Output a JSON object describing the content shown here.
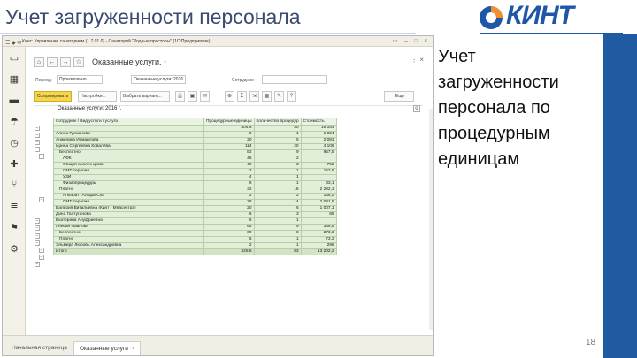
{
  "slide": {
    "title": "Учет загруженности персонала",
    "logo_text": "КИНТ",
    "caption": "Учет загруженности персонала по процедурным единицам",
    "page_number": "18"
  },
  "app": {
    "window_title": "Кинт: Управление санаторием (1.7.01.0) - Санаторий \"Родные просторы\" (1С:Предприятие)",
    "doc_title": "Оказанные услуги.",
    "doc_modified_mark": "*",
    "filters": {
      "period_label": "Период:",
      "period_value": "Произвольно",
      "from_value": "Оказанные услуги: 2016",
      "staff_label": "Сотрудник:",
      "staff_value": ""
    },
    "toolbar": {
      "generate_label": "Сформировать",
      "settings_label": "Настройки...",
      "variant_label": "Выбрать вариант...",
      "more_label": "Еще"
    },
    "report_title": "Оказанные услуги: 2016 г.",
    "table": {
      "headers": [
        "Сотрудник / Вид услуги / услуга",
        "Процедурные единицы",
        "Количество процедур",
        "Стоимость"
      ],
      "rows": [
        {
          "level": 0,
          "name": "",
          "units": "404,5",
          "count": "40",
          "cost": "15 164"
        },
        {
          "level": 0,
          "name": "Алина Гусманова",
          "units": "2",
          "count": "1",
          "cost": "1 024"
        },
        {
          "level": 0,
          "name": "Анжелика Исмаилова",
          "units": "20",
          "count": "5",
          "cost": "2 081"
        },
        {
          "level": 0,
          "name": "Ирина Сергеевна Ковалёва",
          "units": "114",
          "count": "20",
          "cost": "4 106"
        },
        {
          "level": 1,
          "name": "Бесплатно",
          "units": "82",
          "count": "9",
          "cost": "957,5"
        },
        {
          "level": 2,
          "name": "ЛФК",
          "units": "46",
          "count": "2",
          "cost": ""
        },
        {
          "level": 2,
          "name": "Общий анализ крови",
          "units": "46",
          "count": "3",
          "cost": "792"
        },
        {
          "level": 2,
          "name": "СМТ-терапия",
          "units": "2",
          "count": "1",
          "cost": "152,5"
        },
        {
          "level": 2,
          "name": "УЗИ",
          "units": "4",
          "count": "1",
          "cost": ""
        },
        {
          "level": 2,
          "name": "Физиопроцедуры",
          "units": "6",
          "count": "1",
          "cost": "33,1"
        },
        {
          "level": 1,
          "name": "Платно",
          "units": "32",
          "count": "16",
          "cost": "2 282,1"
        },
        {
          "level": 2,
          "name": "Аппарат \"Альфа-Спа\"",
          "units": "2",
          "count": "2",
          "cost": "136,2"
        },
        {
          "level": 2,
          "name": "СМТ-терапия",
          "units": "28",
          "count": "14",
          "cost": "2 081,5"
        },
        {
          "level": 0,
          "name": "Валерия Витальевна (Кинт - Медсестра)",
          "units": "20",
          "count": "6",
          "cost": "1 007,1"
        },
        {
          "level": 0,
          "name": "Дина Галтуганова",
          "units": "6",
          "count": "3",
          "cost": "85"
        },
        {
          "level": 0,
          "name": "Екатерина Ануфриевна",
          "units": "6",
          "count": "1",
          "cost": ""
        },
        {
          "level": 0,
          "name": "Лейсан Павлова",
          "units": "65",
          "count": "9",
          "cost": "346,5"
        },
        {
          "level": 1,
          "name": "Бесплатно",
          "units": "60",
          "count": "8",
          "cost": "273,3"
        },
        {
          "level": 1,
          "name": "Платно",
          "units": "5",
          "count": "1",
          "cost": "73,2"
        },
        {
          "level": 0,
          "name": "Эльмира Любовь Александровна",
          "units": "2",
          "count": "1",
          "cost": "296"
        }
      ],
      "total": {
        "name": "Итого",
        "units": "425,5",
        "count": "83",
        "cost": "13 202,2"
      }
    },
    "tabs": [
      {
        "label": "Начальная страница"
      },
      {
        "label": "Оказанные услуги",
        "close": "×"
      }
    ]
  }
}
